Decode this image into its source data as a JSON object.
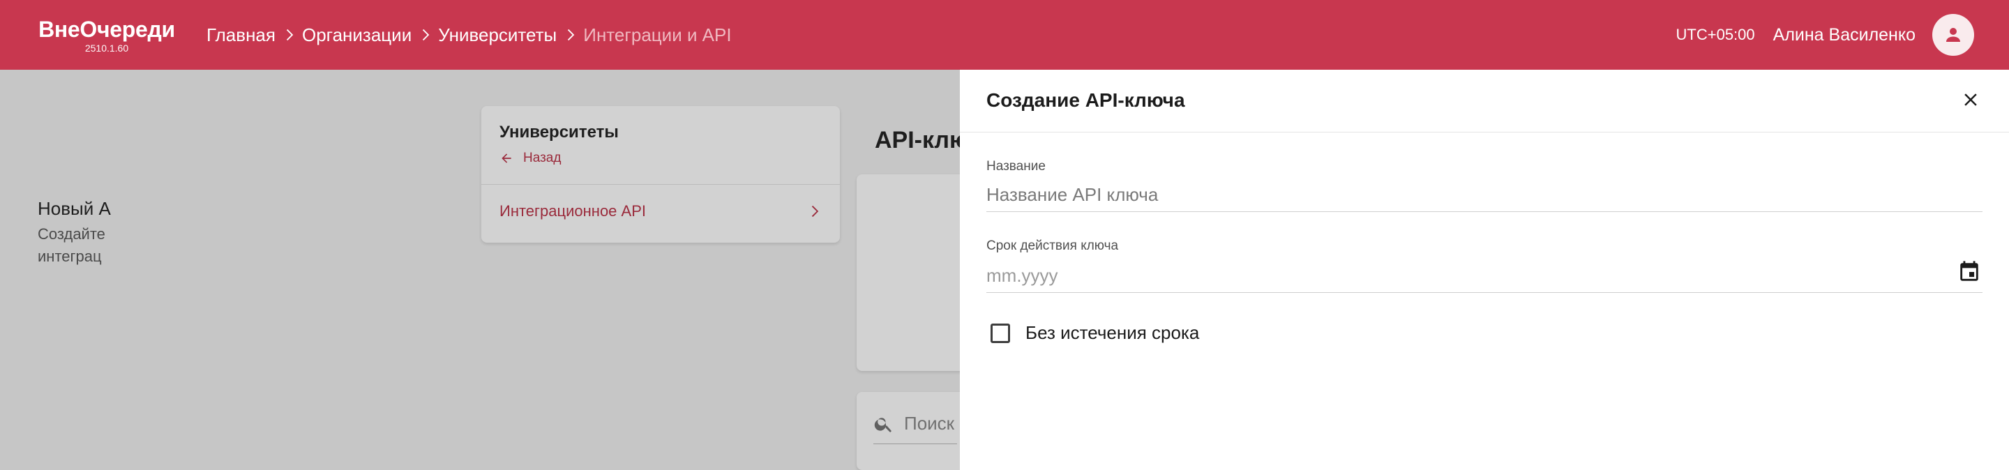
{
  "app": {
    "name": "ВнеОчереди",
    "version": "2510.1.60"
  },
  "breadcrumb": [
    {
      "label": "Главная"
    },
    {
      "label": "Организации"
    },
    {
      "label": "Университеты"
    },
    {
      "label": "Интеграции и API"
    }
  ],
  "header": {
    "timezone": "UTC+05:00",
    "user_name": "Алина Василенко"
  },
  "sidebar": {
    "title": "Университеты",
    "back_label": "Назад",
    "items": [
      {
        "label": "Интеграционное API"
      }
    ]
  },
  "main": {
    "title": "API-клю",
    "new_card": {
      "title": "Новый А",
      "description": "Создайте интеграц"
    },
    "search": {
      "placeholder": "Поиск"
    }
  },
  "drawer": {
    "title": "Создание API-ключа",
    "name_field": {
      "label": "Название",
      "placeholder": "Название API ключа"
    },
    "date_field": {
      "label": "Срок действия ключа",
      "placeholder": "mm.yyyy"
    },
    "no_expiry": {
      "label": "Без истечения срока",
      "checked": false
    }
  },
  "colors": {
    "brand": "#c8374f",
    "accent_text": "#9a2a3b",
    "overlay": "#c6c6c6"
  },
  "icons": {
    "breadcrumb_separator": "chevron-right-icon",
    "avatar": "person-icon",
    "back": "arrow-left-icon",
    "sidebar_item": "chevron-right-icon",
    "search": "search-icon",
    "close": "close-icon",
    "calendar": "calendar-icon"
  }
}
